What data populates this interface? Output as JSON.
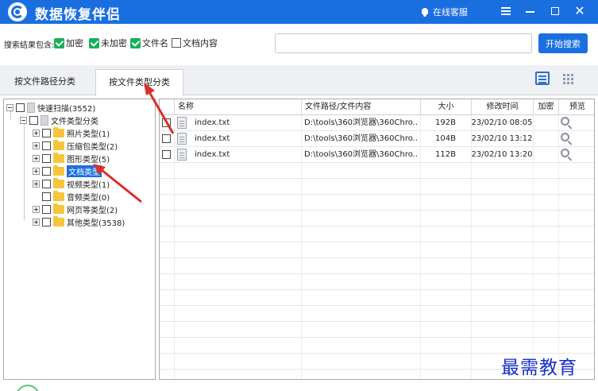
{
  "app": {
    "title": "数据恢复伴侣",
    "service": "在线客服",
    "close_glyph": "✕"
  },
  "search": {
    "include_label": "搜索结果包含:",
    "options": [
      {
        "label": "加密",
        "checked": true
      },
      {
        "label": "未加密",
        "checked": true
      },
      {
        "label": "文件名",
        "checked": true
      },
      {
        "label": "文档内容",
        "checked": false
      }
    ],
    "input_value": "",
    "input_placeholder": "",
    "button_label": "开始搜索"
  },
  "tabs": [
    {
      "label": "按文件路径分类",
      "active": false
    },
    {
      "label": "按文件类型分类",
      "active": true
    }
  ],
  "tree": {
    "root": "快速扫描(3552)",
    "group": "文件类型分类",
    "items": [
      "照片类型(1)",
      "压缩包类型(2)",
      "图形类型(5)",
      "文档类型",
      "视频类型(1)",
      "音频类型(0)",
      "网页等类型(2)",
      "其他类型(3538)"
    ],
    "selected_index": 3
  },
  "table": {
    "columns": [
      "名称",
      "文件路径/文件内容",
      "大小",
      "修改时间",
      "加密",
      "预览"
    ],
    "rows": [
      {
        "name": "index.txt",
        "path": "D:\\tools\\360浏览器\\360Chro...",
        "size": "192B",
        "mtime": "23/02/10 08:05",
        "encrypted": ""
      },
      {
        "name": "index.txt",
        "path": "D:\\tools\\360浏览器\\360Chro...",
        "size": "104B",
        "mtime": "23/02/10 13:12",
        "encrypted": ""
      },
      {
        "name": "index.txt",
        "path": "D:\\tools\\360浏览器\\360Chro...",
        "size": "112B",
        "mtime": "23/02/10 13:20",
        "encrypted": ""
      }
    ]
  },
  "watermark": "最需教育",
  "colors": {
    "brand_blue": "#1a6fe0",
    "check_green": "#17b05a",
    "annotation_red": "#d9302a",
    "folder_yellow": "#f7c53c"
  }
}
